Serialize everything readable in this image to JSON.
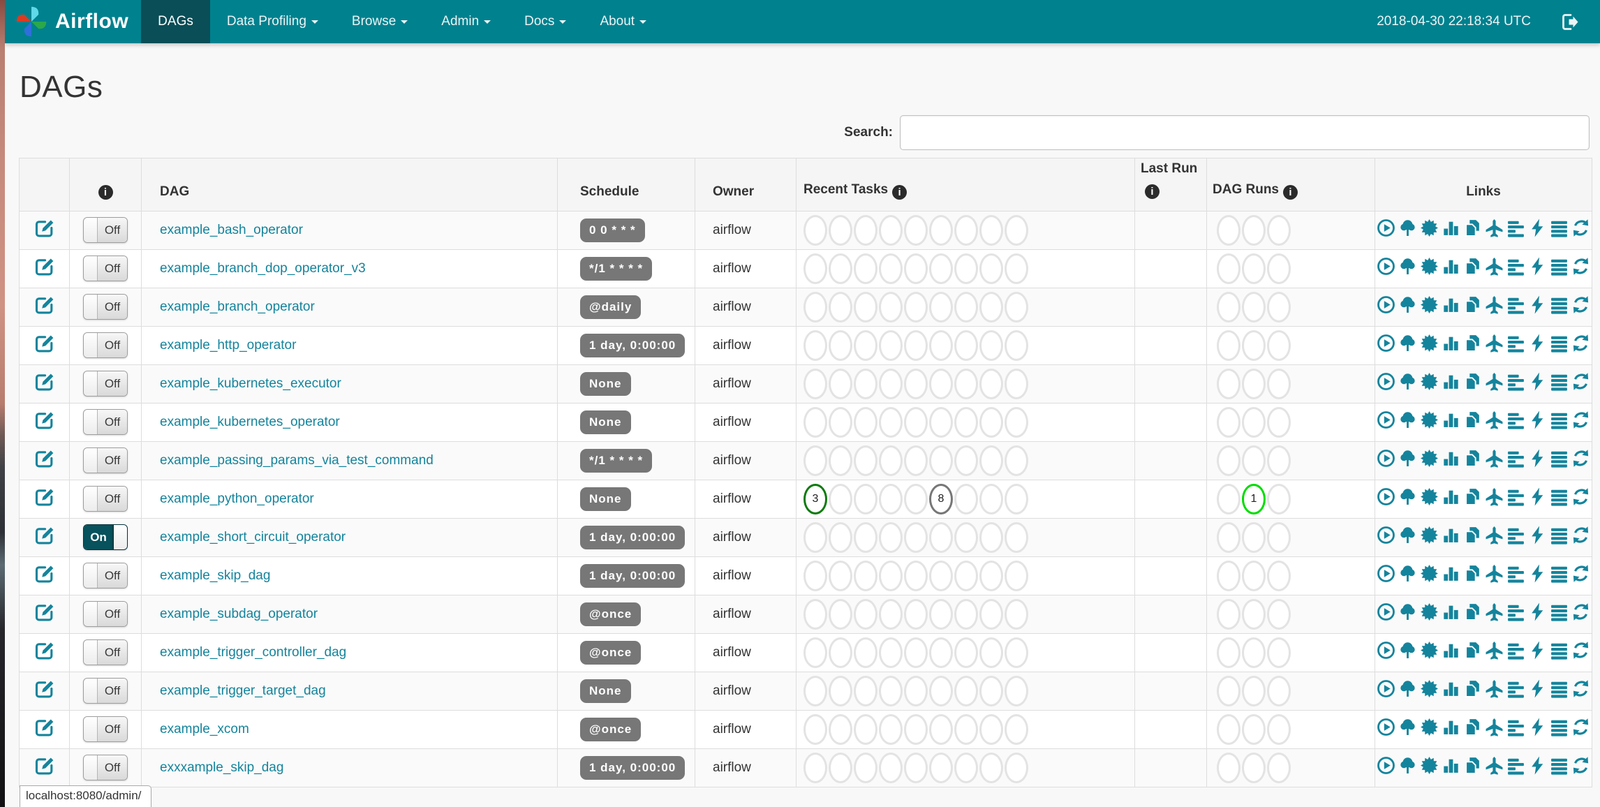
{
  "navbar": {
    "brand": "Airflow",
    "items": [
      {
        "label": "DAGs",
        "active": true,
        "caret": false
      },
      {
        "label": "Data Profiling",
        "active": false,
        "caret": true
      },
      {
        "label": "Browse",
        "active": false,
        "caret": true
      },
      {
        "label": "Admin",
        "active": false,
        "caret": true
      },
      {
        "label": "Docs",
        "active": false,
        "caret": true
      },
      {
        "label": "About",
        "active": false,
        "caret": true
      }
    ],
    "clock": "2018-04-30 22:18:34 UTC",
    "logout_icon": "logout-icon",
    "brand_icon": "airflow-pinwheel-logo"
  },
  "page": {
    "title": "DAGs",
    "search_label": "Search:",
    "search_value": "",
    "search_placeholder": "",
    "status_tooltip": "localhost:8080/admin/"
  },
  "table": {
    "headers": {
      "edit": "",
      "info": "info-icon",
      "dag": "DAG",
      "schedule": "Schedule",
      "owner": "Owner",
      "recent_tasks": "Recent Tasks",
      "last_run": "Last Run",
      "dag_runs": "DAG Runs",
      "links": "Links"
    },
    "recent_task_slots": 9,
    "dag_run_slots": 3,
    "link_icons": [
      "trigger-dag-icon",
      "tree-view-icon",
      "graph-view-icon",
      "task-duration-icon",
      "task-tries-icon",
      "landing-times-icon",
      "gantt-view-icon",
      "code-view-icon",
      "task-instances-icon",
      "refresh-icon"
    ],
    "toggle_on_label": "On",
    "toggle_off_label": "Off",
    "rows": [
      {
        "name": "example_bash_operator",
        "toggle": "Off",
        "schedule": "0 0 * * *",
        "owner": "airflow",
        "recent_tasks": [],
        "dag_runs": []
      },
      {
        "name": "example_branch_dop_operator_v3",
        "toggle": "Off",
        "schedule": "*/1 * * * *",
        "owner": "airflow",
        "recent_tasks": [],
        "dag_runs": []
      },
      {
        "name": "example_branch_operator",
        "toggle": "Off",
        "schedule": "@daily",
        "owner": "airflow",
        "recent_tasks": [],
        "dag_runs": []
      },
      {
        "name": "example_http_operator",
        "toggle": "Off",
        "schedule": "1 day, 0:00:00",
        "owner": "airflow",
        "recent_tasks": [],
        "dag_runs": []
      },
      {
        "name": "example_kubernetes_executor",
        "toggle": "Off",
        "schedule": "None",
        "owner": "airflow",
        "recent_tasks": [],
        "dag_runs": []
      },
      {
        "name": "example_kubernetes_operator",
        "toggle": "Off",
        "schedule": "None",
        "owner": "airflow",
        "recent_tasks": [],
        "dag_runs": []
      },
      {
        "name": "example_passing_params_via_test_command",
        "toggle": "Off",
        "schedule": "*/1 * * * *",
        "owner": "airflow",
        "recent_tasks": [],
        "dag_runs": []
      },
      {
        "name": "example_python_operator",
        "toggle": "Off",
        "schedule": "None",
        "owner": "airflow",
        "recent_tasks": [
          {
            "slot": 0,
            "count": "3",
            "color": "#0e7b0e"
          },
          {
            "slot": 5,
            "count": "8",
            "color": "#777777"
          }
        ],
        "dag_runs": [
          {
            "slot": 1,
            "count": "1",
            "color": "#00dd00"
          }
        ]
      },
      {
        "name": "example_short_circuit_operator",
        "toggle": "On",
        "schedule": "1 day, 0:00:00",
        "owner": "airflow",
        "recent_tasks": [],
        "dag_runs": []
      },
      {
        "name": "example_skip_dag",
        "toggle": "Off",
        "schedule": "1 day, 0:00:00",
        "owner": "airflow",
        "recent_tasks": [],
        "dag_runs": []
      },
      {
        "name": "example_subdag_operator",
        "toggle": "Off",
        "schedule": "@once",
        "owner": "airflow",
        "recent_tasks": [],
        "dag_runs": []
      },
      {
        "name": "example_trigger_controller_dag",
        "toggle": "Off",
        "schedule": "@once",
        "owner": "airflow",
        "recent_tasks": [],
        "dag_runs": []
      },
      {
        "name": "example_trigger_target_dag",
        "toggle": "Off",
        "schedule": "None",
        "owner": "airflow",
        "recent_tasks": [],
        "dag_runs": []
      },
      {
        "name": "example_xcom",
        "toggle": "Off",
        "schedule": "@once",
        "owner": "airflow",
        "recent_tasks": [],
        "dag_runs": []
      },
      {
        "name": "exxxample_skip_dag",
        "toggle": "Off",
        "schedule": "1 day, 0:00:00",
        "owner": "airflow",
        "recent_tasks": [],
        "dag_runs": []
      }
    ]
  },
  "colors": {
    "navbar": "#00818e",
    "navbar_active": "#0a4e57",
    "accent_teal": "#14849c",
    "schedule_badge": "#777777",
    "task_success_green": "#0e7b0e",
    "task_queued_gray": "#777777",
    "dagrun_running_lime": "#00dd00",
    "empty_circle": "#e3e3e3",
    "toggle_on": "#07525c"
  }
}
